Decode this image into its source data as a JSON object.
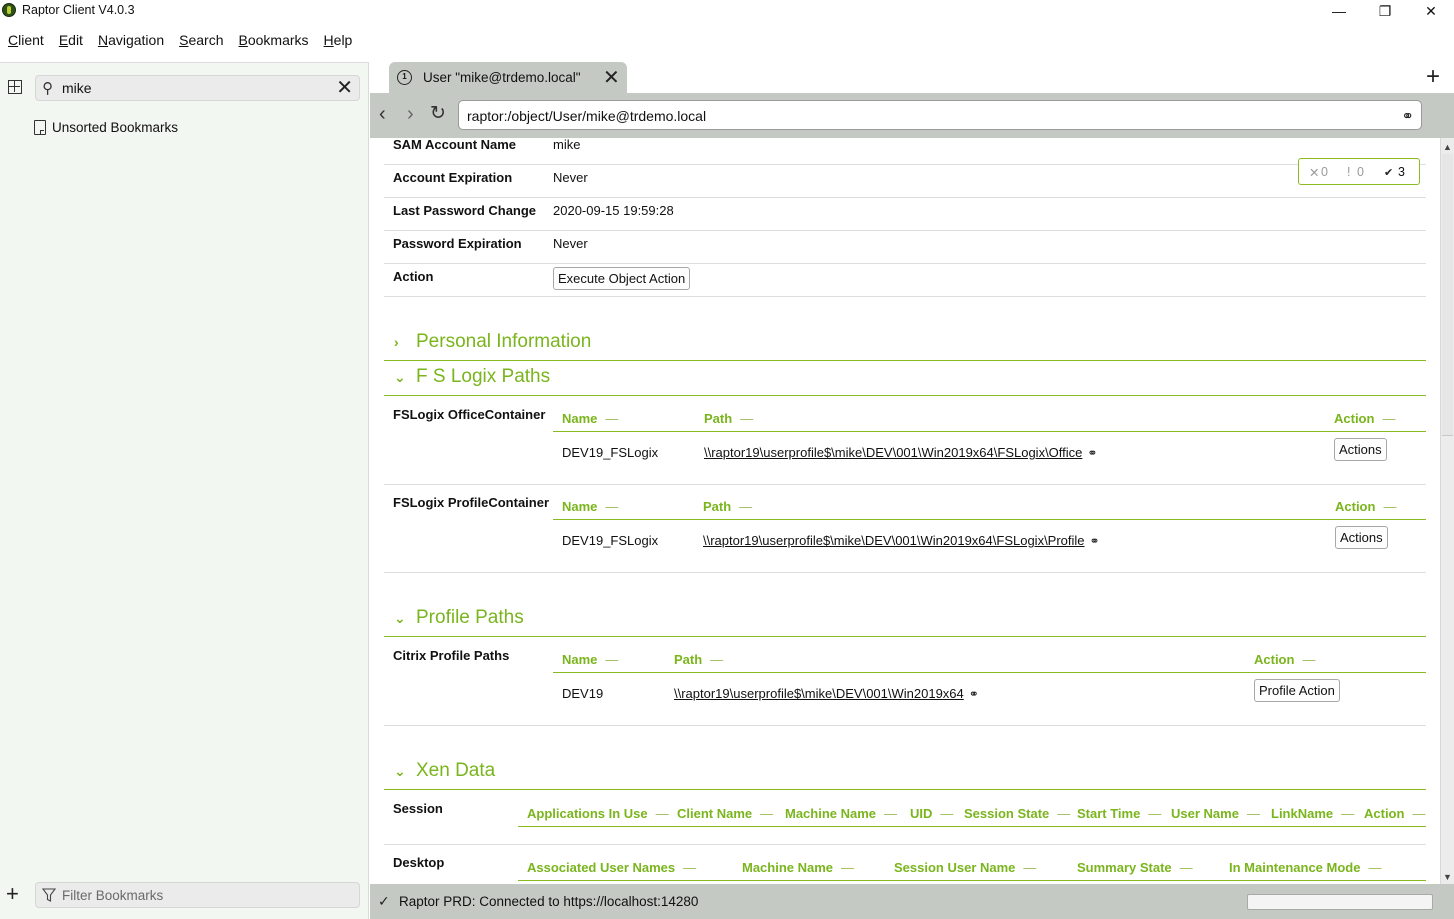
{
  "window": {
    "title": "Raptor Client V4.0.3",
    "controls": {
      "minimize": "—",
      "restore": "❐",
      "close": "✕"
    }
  },
  "menu": [
    {
      "label": "Client",
      "accel": "C",
      "rest": "lient"
    },
    {
      "label": "Edit",
      "accel": "E",
      "rest": "dit"
    },
    {
      "label": "Navigation",
      "accel": "N",
      "rest": "avigation"
    },
    {
      "label": "Search",
      "accel": "S",
      "rest": "earch"
    },
    {
      "label": "Bookmarks",
      "accel": "B",
      "rest": "ookmarks"
    },
    {
      "label": "Help",
      "accel": "H",
      "rest": "elp"
    }
  ],
  "sidebar": {
    "search_value": "mike",
    "bookmark_folder": "Unsorted Bookmarks",
    "filter_placeholder": "Filter Bookmarks",
    "icons": {
      "grid": "grid-icon",
      "search": "search-icon",
      "clear": "close-icon",
      "add": "plus-icon",
      "filter": "filter-icon"
    }
  },
  "tabs": [
    {
      "label": "User \"mike@trdemo.local\"",
      "icon": "object-icon",
      "active": true
    }
  ],
  "navigation": {
    "back": "‹",
    "forward": "›",
    "refresh": "↻",
    "address": "raptor:/object/User/mike@trdemo.local"
  },
  "status_badge": {
    "errors": "0",
    "warnings": "0",
    "ok": "3"
  },
  "properties": [
    {
      "label": "SAM Account Name",
      "value": "mike"
    },
    {
      "label": "Account Expiration",
      "value": "Never"
    },
    {
      "label": "Last Password Change",
      "value": "2020-09-15 19:59:28"
    },
    {
      "label": "Password Expiration",
      "value": "Never"
    },
    {
      "label": "Action",
      "button": "Execute Object Action"
    }
  ],
  "sections": {
    "personal": {
      "title": "Personal Information",
      "expanded": false
    },
    "fslogix": {
      "title": "F S Logix Paths",
      "expanded": true,
      "groups": [
        {
          "label": "FSLogix OfficeContainer",
          "headers": [
            "Name",
            "Path",
            "Action"
          ],
          "rows": [
            {
              "name": "DEV19_FSLogix",
              "path": "\\\\raptor19\\userprofile$\\mike\\DEV\\001\\Win2019x64\\FSLogix\\Office",
              "action": "Actions"
            }
          ]
        },
        {
          "label": "FSLogix ProfileContainer",
          "headers": [
            "Name",
            "Path",
            "Action"
          ],
          "rows": [
            {
              "name": "DEV19_FSLogix",
              "path": "\\\\raptor19\\userprofile$\\mike\\DEV\\001\\Win2019x64\\FSLogix\\Profile",
              "action": "Actions"
            }
          ]
        }
      ]
    },
    "profile": {
      "title": "Profile Paths",
      "expanded": true,
      "groups": [
        {
          "label": "Citrix Profile Paths",
          "headers": [
            "Name",
            "Path",
            "Action"
          ],
          "rows": [
            {
              "name": "DEV19",
              "path": "\\\\raptor19\\userprofile$\\mike\\DEV\\001\\Win2019x64",
              "action": "Profile Action"
            }
          ]
        }
      ]
    },
    "xen": {
      "title": "Xen Data",
      "expanded": true,
      "groups": [
        {
          "label": "Session",
          "headers": [
            "Applications In Use",
            "Client Name",
            "Machine Name",
            "UID",
            "Session State",
            "Start Time",
            "User Name",
            "LinkName",
            "Action"
          ]
        },
        {
          "label": "Desktop",
          "headers": [
            "Associated User Names",
            "Machine Name",
            "Session User Name",
            "Summary State",
            "In Maintenance Mode"
          ]
        }
      ]
    }
  },
  "statusbar": {
    "icon": "check-icon",
    "text": "Raptor PRD: Connected to https://localhost:14280"
  },
  "colors": {
    "accent": "#7ab51d",
    "panel_bg": "#f3f7f1",
    "chrome_bg": "#c5c9c3"
  }
}
